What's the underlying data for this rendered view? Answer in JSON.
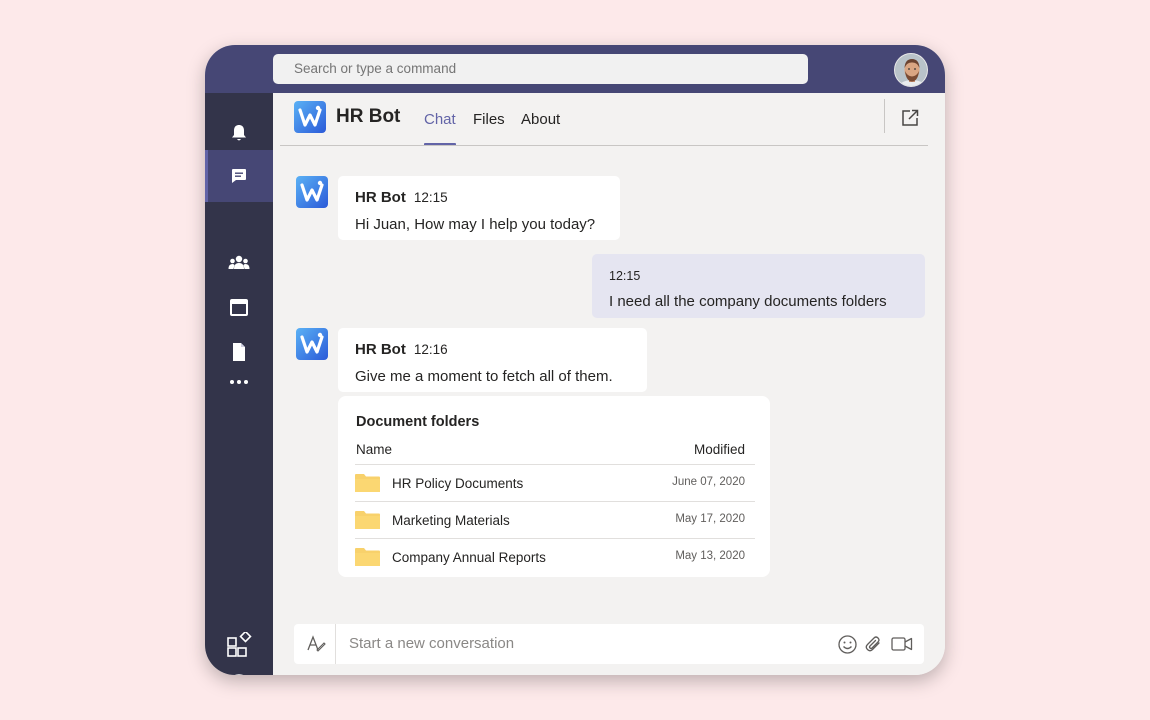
{
  "topbar": {
    "search_placeholder": "Search or type a command",
    "avatar_alt": "user-avatar"
  },
  "rail": {
    "items": [
      {
        "name": "activity",
        "icon": "bell-icon"
      },
      {
        "name": "chat",
        "icon": "chat-icon",
        "active": true
      },
      {
        "name": "teams",
        "icon": "teams-icon"
      },
      {
        "name": "calendar",
        "icon": "calendar-icon"
      },
      {
        "name": "files",
        "icon": "file-icon"
      },
      {
        "name": "more",
        "icon": "more-icon"
      }
    ],
    "bottom": [
      {
        "name": "apps",
        "icon": "apps-icon"
      },
      {
        "name": "help",
        "icon": "help-icon"
      }
    ]
  },
  "header": {
    "app_title": "HR Bot",
    "tabs": [
      {
        "label": "Chat",
        "active": true
      },
      {
        "label": "Files"
      },
      {
        "label": "About"
      }
    ],
    "popout_icon": "popout-icon"
  },
  "messages": [
    {
      "author": "HR Bot",
      "time": "12:15",
      "text": "Hi Juan, How may I help you today?"
    },
    {
      "author": "",
      "time": "12:15",
      "text": "I need all the company documents folders",
      "mine": true
    },
    {
      "author": "HR Bot",
      "time": "12:16",
      "text": "Give me a moment to fetch all of them."
    }
  ],
  "card": {
    "title": "Document folders",
    "columns": {
      "name": "Name",
      "modified": "Modified"
    },
    "rows": [
      {
        "name": "HR Policy Documents",
        "modified": "June 07, 2020"
      },
      {
        "name": "Marketing Materials",
        "modified": "May 17, 2020"
      },
      {
        "name": "Company Annual Reports",
        "modified": "May 13, 2020"
      }
    ]
  },
  "composer": {
    "placeholder": "Start a new conversation"
  },
  "colors": {
    "accent": "#6264a7",
    "topbar": "#464775",
    "rail": "#33344a",
    "background": "#fde9ea",
    "folder": "#f8d16b"
  }
}
